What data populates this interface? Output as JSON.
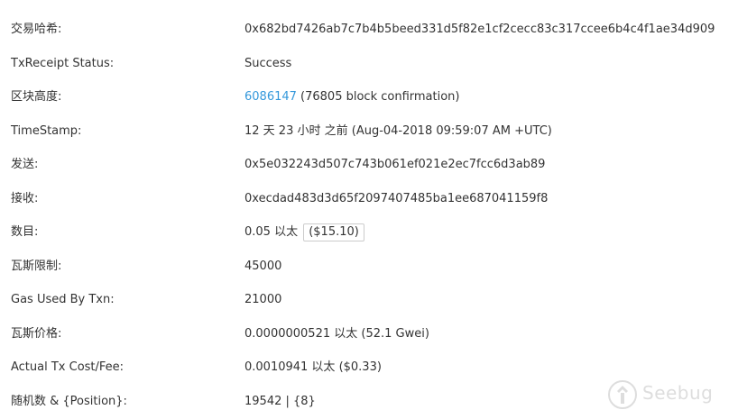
{
  "rows": [
    {
      "label": "交易哈希:",
      "value": "0x682bd7426ab7c7b4b5beed331d5f82e1cf2cecc83c317ccee6b4c4f1ae34d909"
    },
    {
      "label": "TxReceipt Status:",
      "value": "Success"
    },
    {
      "label": "区块高度:",
      "link": "6086147",
      "suffix": " (76805 block confirmation)"
    },
    {
      "label": "TimeStamp:",
      "value": "12 天 23 小时 之前 (Aug-04-2018 09:59:07 AM +UTC)"
    },
    {
      "label": "发送:",
      "link": "0x5e032243d507c743b061ef021e2ec7fcc6d3ab89"
    },
    {
      "label": "接收:",
      "link": "0xecdad483d3d65f2097407485ba1ee687041159f8"
    },
    {
      "label": "数目:",
      "value": "0.05 以太",
      "price": "($15.10)"
    },
    {
      "label": "瓦斯限制:",
      "value": "45000"
    },
    {
      "label": "Gas Used By Txn:",
      "value": "21000"
    },
    {
      "label": "瓦斯价格:",
      "value": "0.0000000521 以太 (52.1 Gwei)"
    },
    {
      "label": "Actual Tx Cost/Fee:",
      "value": "0.0010941 以太 ($0.33)"
    },
    {
      "label": "随机数 & {Position}:",
      "value": "19542 | {8}"
    }
  ],
  "watermark": {
    "text": "Seebug",
    "icon": "seebug-logo-icon"
  },
  "colors": {
    "link": "#3498db",
    "success": "#1e8a1e",
    "text": "#333333"
  }
}
